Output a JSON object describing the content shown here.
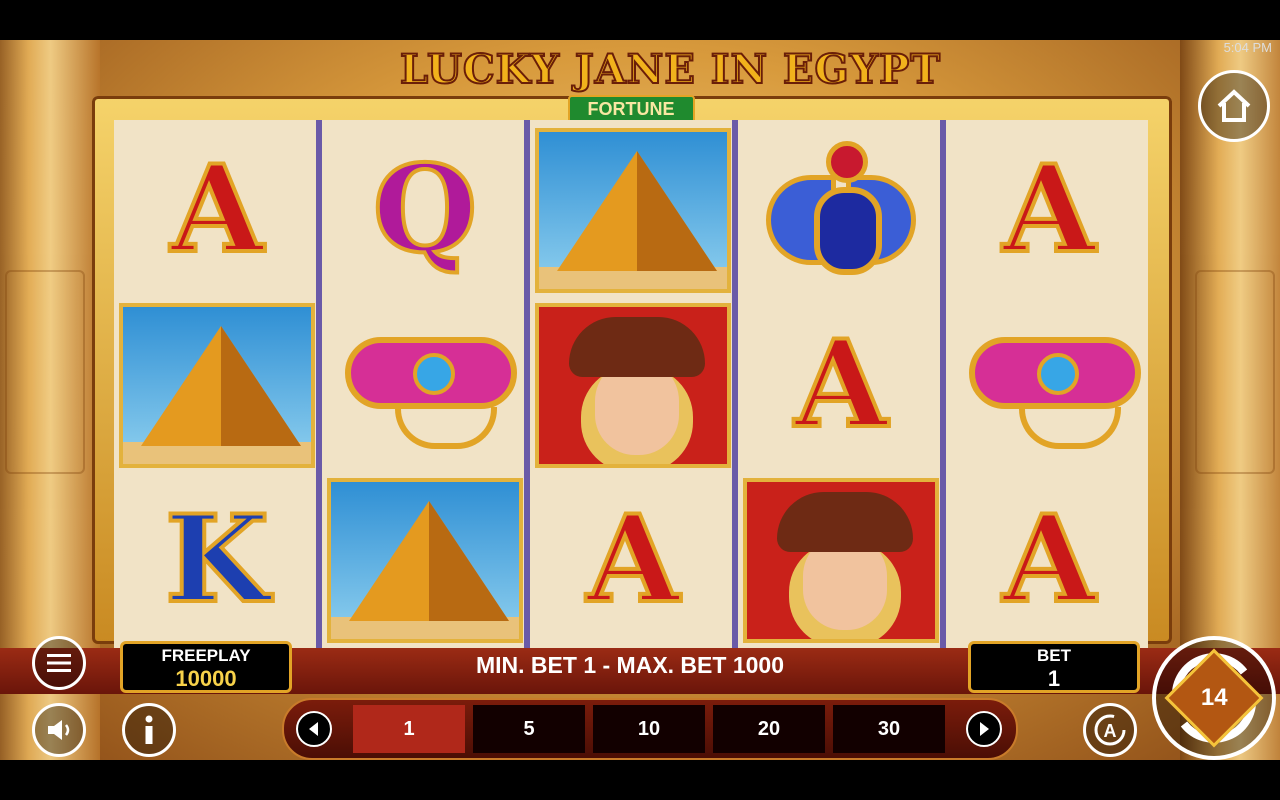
{
  "status": {
    "time": "5:04 PM"
  },
  "logo": {
    "title": "LUCKY JANE IN EGYPT",
    "subtitle": "FORTUNE"
  },
  "reels": [
    [
      "A",
      "pyramid",
      "K"
    ],
    [
      "Q",
      "eye",
      "pyramid"
    ],
    [
      "pyramid",
      "jane",
      "A"
    ],
    [
      "scarab",
      "A",
      "jane"
    ],
    [
      "A",
      "eye",
      "A"
    ]
  ],
  "freeplay": {
    "label": "FREEPLAY",
    "value": "10000"
  },
  "bet_limits": "MIN. BET 1 - MAX. BET 1000",
  "bet": {
    "label": "BET",
    "value": "1"
  },
  "bet_options": [
    "1",
    "5",
    "10",
    "20",
    "30"
  ],
  "selected_bet": "1",
  "icons": {
    "home": "home-icon",
    "menu": "hamburger-menu-icon",
    "sound": "speaker-icon",
    "info": "info-icon",
    "auto": "autoplay-icon",
    "spin": "spin-icon",
    "prev": "chevron-left-icon",
    "next": "chevron-right-icon"
  },
  "spin_badge": "14"
}
